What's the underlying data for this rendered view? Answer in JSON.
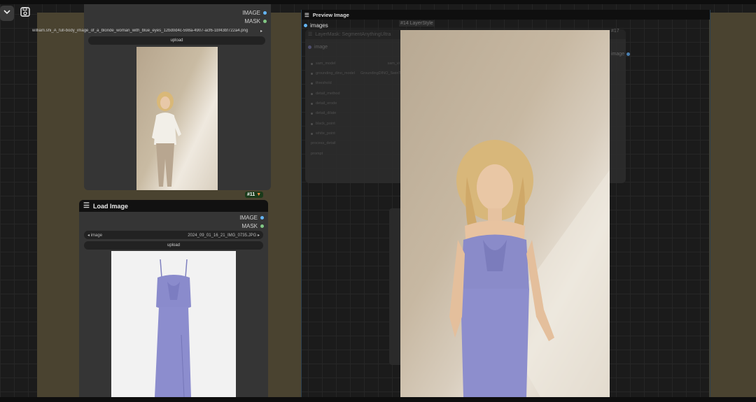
{
  "toolbar": {
    "menu_icon": "chevron-down-icon",
    "save_icon": "floppy-disk-icon"
  },
  "node_top": {
    "outputs": [
      "IMAGE",
      "MASK"
    ],
    "image_value": "william.shi_A_full-body_image_of_a_blonde_woman_with_blue_eyes_12bd0d4c-598a-4907-acf6-1bf43bf722a4.png",
    "upload": "upload"
  },
  "node_load": {
    "badge": "#11",
    "title": "Load Image",
    "outputs": [
      "IMAGE",
      "MASK"
    ],
    "image_label": "image",
    "image_value": "2024_09_01_16_21_IMG_0735.JPG",
    "upload": "upload"
  },
  "node_preview": {
    "title": "Preview Image",
    "input": "images"
  },
  "node_layermask": {
    "title": "LayerMask: SegmentAnythingUltra",
    "badge": "#14 LayerStyle",
    "input": "image",
    "widgets": [
      "sam_model",
      "grounding_dino_model",
      "threshold",
      "detail_method",
      "detail_erode",
      "detail_dilate",
      "black_point",
      "white_point",
      "process_detail",
      "prompt"
    ],
    "value_fragment": "sam_vi",
    "value_fragment_2": "GroundingDINO_SwinT_OGC"
  },
  "node_17": {
    "badge": "#17",
    "output": "image"
  },
  "colors": {
    "image_dot": "#64b5f6",
    "mask_dot": "#81c784",
    "group_bg": "#4a4330"
  }
}
